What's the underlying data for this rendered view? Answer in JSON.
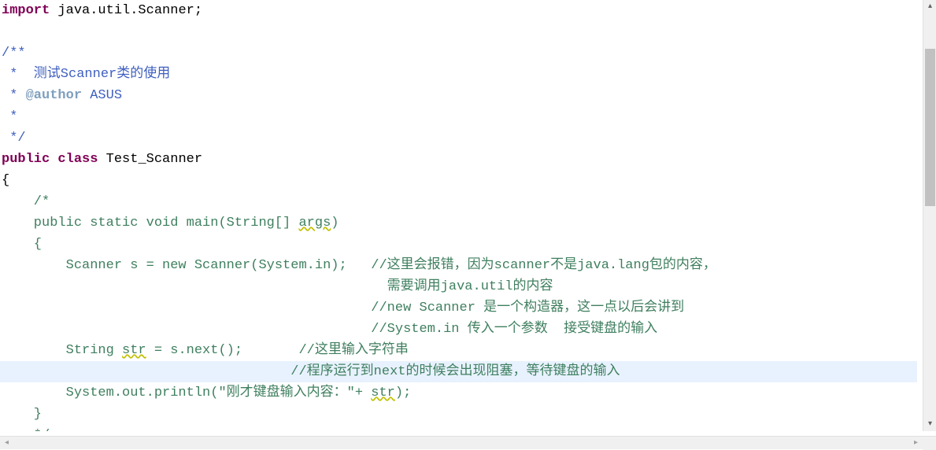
{
  "code": {
    "line0_import": "import",
    "line0_rest": " java.util.Scanner;",
    "line1": "",
    "line2": "/**",
    "line3_prefix": " * ",
    "line3_text": " 测试Scanner类的使用",
    "line4_prefix": " * ",
    "line4_tag": "@author",
    "line4_name": " ASUS",
    "line5": " *",
    "line6": " */",
    "line7_public": "public",
    "line7_class": " class",
    "line7_name": " Test_Scanner",
    "line8": "{",
    "line9": "    /*",
    "line10_a": "    public static void main(String[] ",
    "line10_args": "args",
    "line10_b": ")",
    "line11": "    {",
    "line12": "        Scanner s = new Scanner(System.in);   //这里会报错，因为scanner不是java.lang包的内容，",
    "line13": "                                                需要调用java.util的内容",
    "line14": "                                              //new Scanner 是一个构造器，这一点以后会讲到",
    "line15": "                                              //System.in 传入一个参数  接受键盘的输入",
    "line16_a": "        String ",
    "line16_str": "str",
    "line16_b": " = s.next();       //这里输入字符串",
    "line17": "                                    //程序运行到next的时候会出现阻塞，等待键盘的输入",
    "line18_a": "        System.out.println(",
    "line18_string": "\"刚才键盘输入内容：\"",
    "line18_b": "+ ",
    "line18_str": "str",
    "line18_c": ");",
    "line19": "    }",
    "line20": "    */"
  }
}
